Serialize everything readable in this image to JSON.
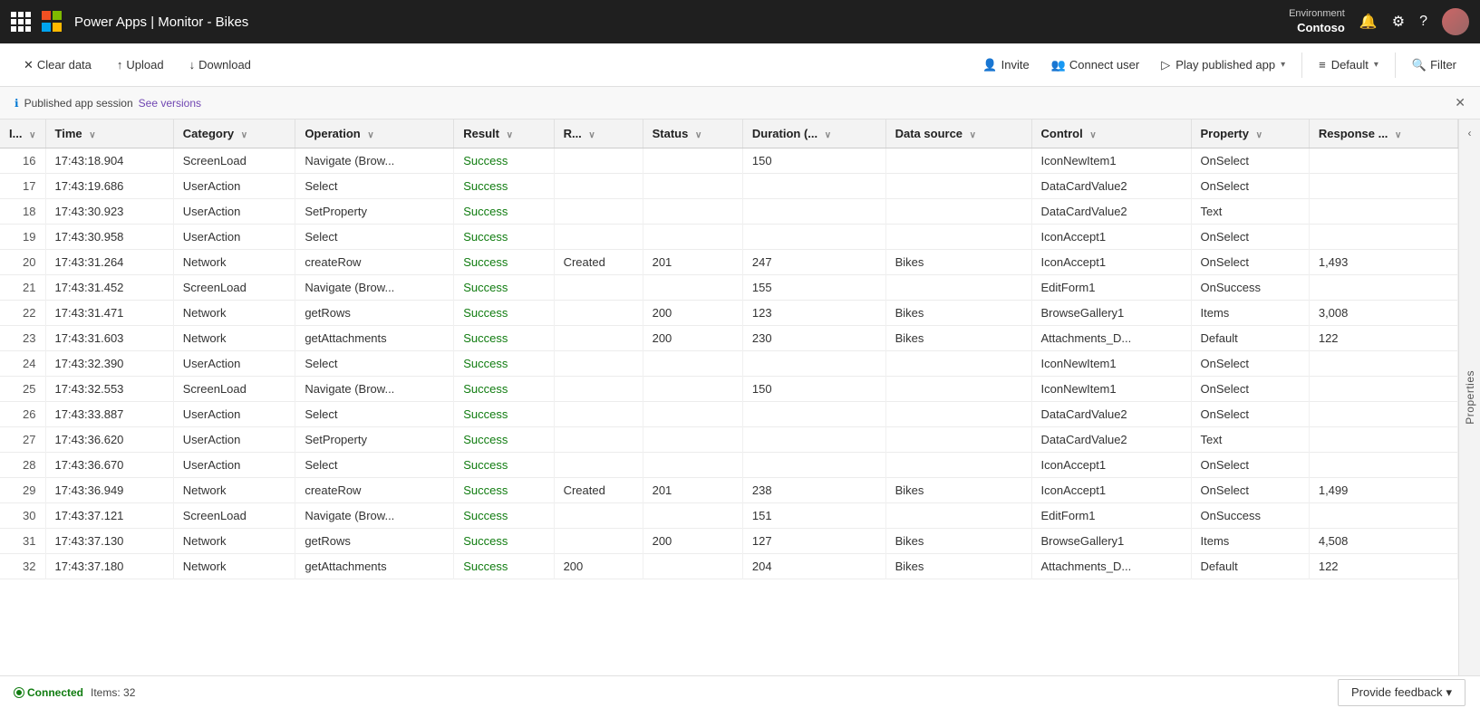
{
  "topnav": {
    "app_title": "Power Apps | Monitor - Bikes",
    "env_label": "Environment",
    "env_name": "Contoso"
  },
  "toolbar": {
    "clear_data": "Clear data",
    "upload": "Upload",
    "download": "Download",
    "invite": "Invite",
    "connect_user": "Connect user",
    "play_published_app": "Play published app",
    "default": "Default",
    "filter": "Filter"
  },
  "info_bar": {
    "text": "Published app session",
    "link": "See versions"
  },
  "table": {
    "columns": [
      {
        "id": "id",
        "label": "I...",
        "sortable": true
      },
      {
        "id": "time",
        "label": "Time",
        "sortable": true
      },
      {
        "id": "category",
        "label": "Category",
        "sortable": true
      },
      {
        "id": "operation",
        "label": "Operation",
        "sortable": true
      },
      {
        "id": "result",
        "label": "Result",
        "sortable": true
      },
      {
        "id": "r",
        "label": "R...",
        "sortable": true
      },
      {
        "id": "status",
        "label": "Status",
        "sortable": true
      },
      {
        "id": "duration",
        "label": "Duration (...",
        "sortable": true
      },
      {
        "id": "datasource",
        "label": "Data source",
        "sortable": true
      },
      {
        "id": "control",
        "label": "Control",
        "sortable": true
      },
      {
        "id": "property",
        "label": "Property",
        "sortable": true
      },
      {
        "id": "response",
        "label": "Response ...",
        "sortable": true
      }
    ],
    "rows": [
      {
        "id": 16,
        "time": "17:43:18.904",
        "category": "ScreenLoad",
        "operation": "Navigate (Brow...",
        "result": "Success",
        "r": "",
        "status": "",
        "duration": 150,
        "datasource": "",
        "control": "IconNewItem1",
        "property": "OnSelect",
        "response": ""
      },
      {
        "id": 17,
        "time": "17:43:19.686",
        "category": "UserAction",
        "operation": "Select",
        "result": "Success",
        "r": "",
        "status": "",
        "duration": "",
        "datasource": "",
        "control": "DataCardValue2",
        "property": "OnSelect",
        "response": ""
      },
      {
        "id": 18,
        "time": "17:43:30.923",
        "category": "UserAction",
        "operation": "SetProperty",
        "result": "Success",
        "r": "",
        "status": "",
        "duration": "",
        "datasource": "",
        "control": "DataCardValue2",
        "property": "Text",
        "response": ""
      },
      {
        "id": 19,
        "time": "17:43:30.958",
        "category": "UserAction",
        "operation": "Select",
        "result": "Success",
        "r": "",
        "status": "",
        "duration": "",
        "datasource": "",
        "control": "IconAccept1",
        "property": "OnSelect",
        "response": ""
      },
      {
        "id": 20,
        "time": "17:43:31.264",
        "category": "Network",
        "operation": "createRow",
        "result": "Success",
        "r": "Created",
        "status": 201,
        "duration": 247,
        "datasource": "Bikes",
        "control": "IconAccept1",
        "property": "OnSelect",
        "response": "1,493"
      },
      {
        "id": 21,
        "time": "17:43:31.452",
        "category": "ScreenLoad",
        "operation": "Navigate (Brow...",
        "result": "Success",
        "r": "",
        "status": "",
        "duration": 155,
        "datasource": "",
        "control": "EditForm1",
        "property": "OnSuccess",
        "response": ""
      },
      {
        "id": 22,
        "time": "17:43:31.471",
        "category": "Network",
        "operation": "getRows",
        "result": "Success",
        "r": "",
        "status": 200,
        "duration": 123,
        "datasource": "Bikes",
        "control": "BrowseGallery1",
        "property": "Items",
        "response": "3,008"
      },
      {
        "id": 23,
        "time": "17:43:31.603",
        "category": "Network",
        "operation": "getAttachments",
        "result": "Success",
        "r": "",
        "status": 200,
        "duration": 230,
        "datasource": "Bikes",
        "control": "Attachments_D...",
        "property": "Default",
        "response": 122
      },
      {
        "id": 24,
        "time": "17:43:32.390",
        "category": "UserAction",
        "operation": "Select",
        "result": "Success",
        "r": "",
        "status": "",
        "duration": "",
        "datasource": "",
        "control": "IconNewItem1",
        "property": "OnSelect",
        "response": ""
      },
      {
        "id": 25,
        "time": "17:43:32.553",
        "category": "ScreenLoad",
        "operation": "Navigate (Brow...",
        "result": "Success",
        "r": "",
        "status": "",
        "duration": 150,
        "datasource": "",
        "control": "IconNewItem1",
        "property": "OnSelect",
        "response": ""
      },
      {
        "id": 26,
        "time": "17:43:33.887",
        "category": "UserAction",
        "operation": "Select",
        "result": "Success",
        "r": "",
        "status": "",
        "duration": "",
        "datasource": "",
        "control": "DataCardValue2",
        "property": "OnSelect",
        "response": ""
      },
      {
        "id": 27,
        "time": "17:43:36.620",
        "category": "UserAction",
        "operation": "SetProperty",
        "result": "Success",
        "r": "",
        "status": "",
        "duration": "",
        "datasource": "",
        "control": "DataCardValue2",
        "property": "Text",
        "response": ""
      },
      {
        "id": 28,
        "time": "17:43:36.670",
        "category": "UserAction",
        "operation": "Select",
        "result": "Success",
        "r": "",
        "status": "",
        "duration": "",
        "datasource": "",
        "control": "IconAccept1",
        "property": "OnSelect",
        "response": ""
      },
      {
        "id": 29,
        "time": "17:43:36.949",
        "category": "Network",
        "operation": "createRow",
        "result": "Success",
        "r": "Created",
        "status": 201,
        "duration": 238,
        "datasource": "Bikes",
        "control": "IconAccept1",
        "property": "OnSelect",
        "response": "1,499"
      },
      {
        "id": 30,
        "time": "17:43:37.121",
        "category": "ScreenLoad",
        "operation": "Navigate (Brow...",
        "result": "Success",
        "r": "",
        "status": "",
        "duration": 151,
        "datasource": "",
        "control": "EditForm1",
        "property": "OnSuccess",
        "response": ""
      },
      {
        "id": 31,
        "time": "17:43:37.130",
        "category": "Network",
        "operation": "getRows",
        "result": "Success",
        "r": "",
        "status": 200,
        "duration": 127,
        "datasource": "Bikes",
        "control": "BrowseGallery1",
        "property": "Items",
        "response": "4,508"
      },
      {
        "id": 32,
        "time": "17:43:37.180",
        "category": "Network",
        "operation": "getAttachments",
        "result": "Success",
        "r": "200",
        "status": "",
        "duration": 204,
        "datasource": "Bikes",
        "control": "Attachments_D...",
        "property": "Default",
        "response": 122
      }
    ]
  },
  "sidebar": {
    "label": "Properties"
  },
  "status_bar": {
    "connected": "Connected",
    "items_label": "Items: 32",
    "feedback": "Provide feedback"
  }
}
